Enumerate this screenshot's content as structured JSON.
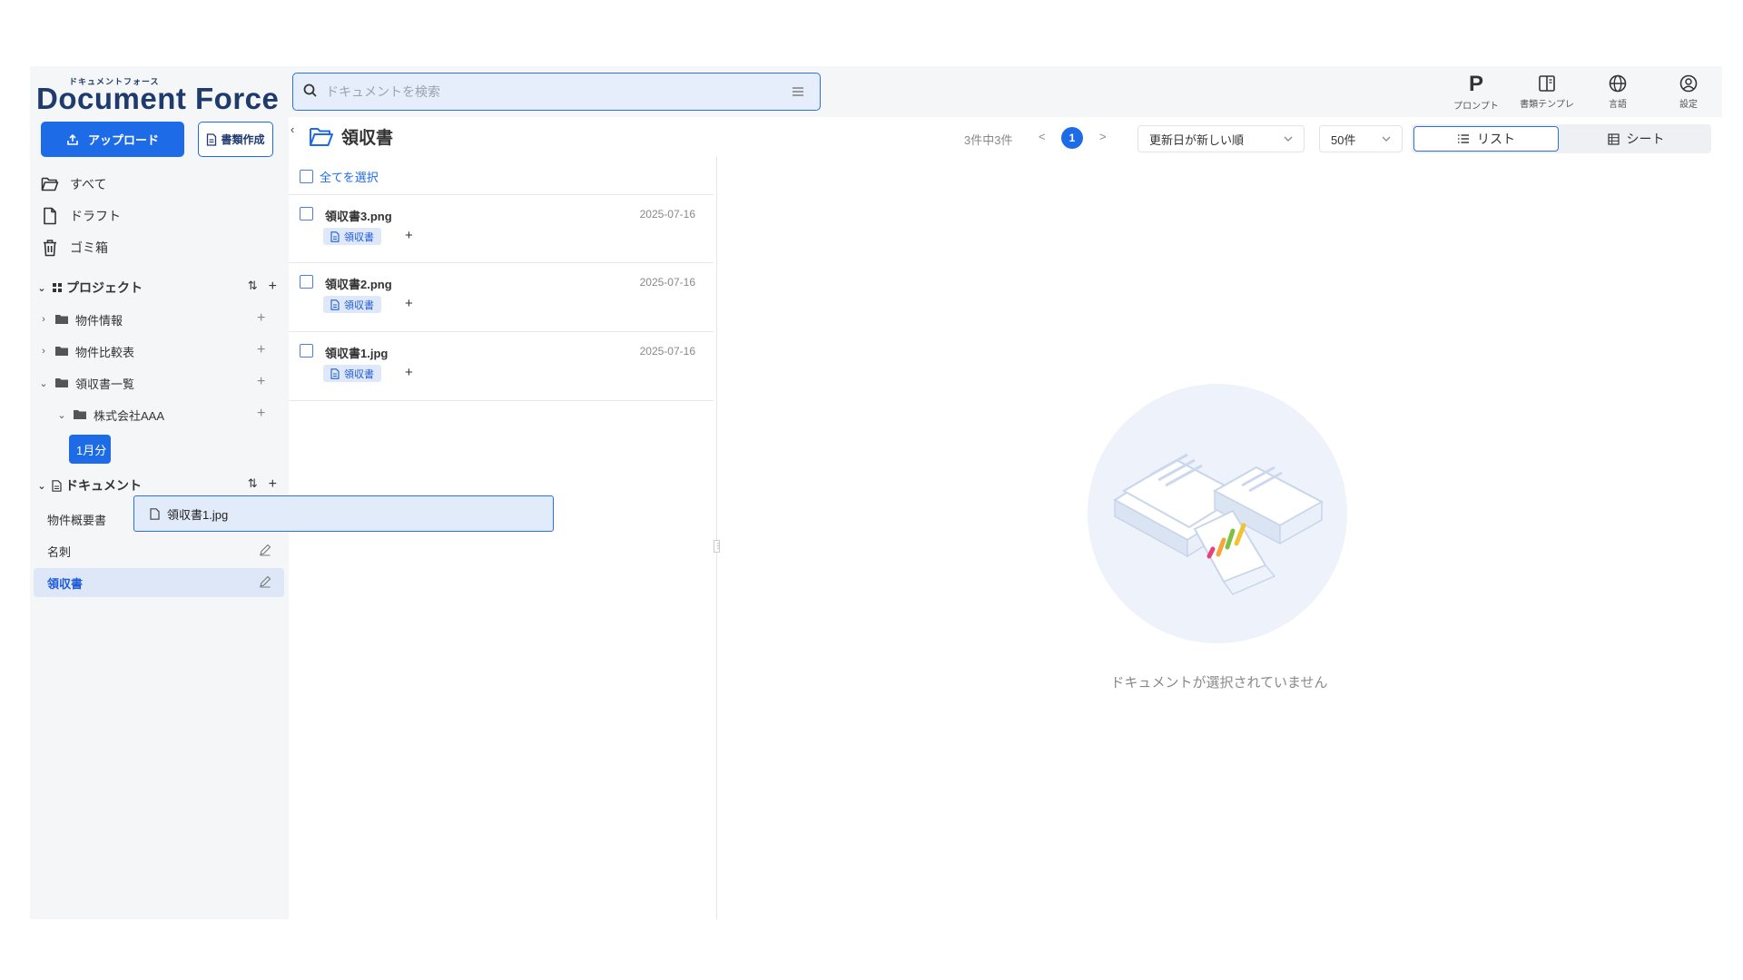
{
  "app": {
    "logo_kana": "ドキュメントフォース",
    "logo_name": "Document Force"
  },
  "search": {
    "placeholder": "ドキュメントを検索"
  },
  "toolbar": {
    "items": [
      {
        "label": "プロンプト",
        "icon": "prompt-p-icon"
      },
      {
        "label": "書類テンプレ",
        "icon": "template-book-icon"
      },
      {
        "label": "言語",
        "icon": "globe-icon"
      },
      {
        "label": "設定",
        "icon": "user-circle-icon"
      }
    ]
  },
  "sidebar": {
    "upload_label": "アップロード",
    "create_label": "書類作成",
    "nav": [
      {
        "label": "すべて",
        "icon": "folder-open-icon"
      },
      {
        "label": "ドラフト",
        "icon": "file-icon"
      },
      {
        "label": "ゴミ箱",
        "icon": "trash-icon"
      }
    ],
    "projects_title": "プロジェクト",
    "projects": [
      {
        "label": "物件情報",
        "expanded": false
      },
      {
        "label": "物件比較表",
        "expanded": false
      },
      {
        "label": "領収書一覧",
        "expanded": true
      },
      {
        "label": "株式会社AAA",
        "expanded": true
      },
      {
        "label": "1月分",
        "selected": true
      }
    ],
    "documents_title": "ドキュメント",
    "documents": [
      {
        "label": "物件概要書",
        "active": false
      },
      {
        "label": "名刺",
        "active": false
      },
      {
        "label": "領収書",
        "active": true
      }
    ]
  },
  "list": {
    "title": "領収書",
    "select_all": "全てを選択",
    "files": [
      {
        "name": "領収書3.png",
        "date": "2025-07-16",
        "tag": "領収書"
      },
      {
        "name": "領収書2.png",
        "date": "2025-07-16",
        "tag": "領収書"
      },
      {
        "name": "領収書1.jpg",
        "date": "2025-07-16",
        "tag": "領収書"
      }
    ]
  },
  "pager": {
    "summary": "3件中3件",
    "prev": "<",
    "current_page": "1",
    "next": ">",
    "sort_value": "更新日が新しい順",
    "per_page": "50件"
  },
  "view_toggle": {
    "list_label": "リスト",
    "sheet_label": "シート",
    "active": "list"
  },
  "preview": {
    "empty_text": "ドキュメントが選択されていません"
  },
  "drag_ghost": {
    "label": "領収書1.jpg"
  },
  "colors": {
    "accent": "#1e6be8",
    "active_bg": "#dde7f8",
    "sidebar_bg": "#f5f6f8"
  }
}
